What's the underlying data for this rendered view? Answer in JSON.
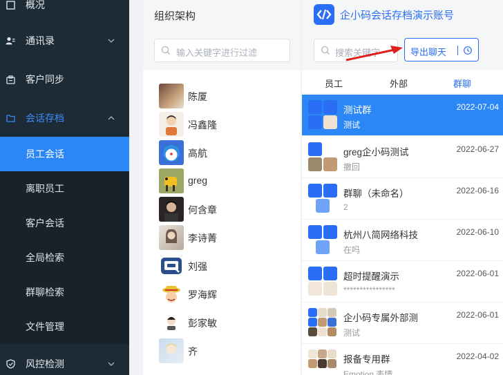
{
  "sidebar": {
    "items": [
      {
        "label": "概况",
        "icon": "dashboard-icon"
      },
      {
        "label": "通讯录",
        "icon": "contacts-icon"
      },
      {
        "label": "客户同步",
        "icon": "sync-icon"
      },
      {
        "label": "会话存档",
        "icon": "folder-icon"
      },
      {
        "label": "风控检测",
        "icon": "shield-icon"
      }
    ],
    "sub_items": [
      "员工会话",
      "离职员工",
      "客户会话",
      "全局检索",
      "群聊检索",
      "文件管理"
    ],
    "active_sub": "员工会话",
    "accent": "#2b87f5"
  },
  "org": {
    "title": "组织架构",
    "search_placeholder": "输入关键字进行过滤",
    "people": [
      "陈厦",
      "冯鑫隆",
      "高航",
      "greg",
      "何含章",
      "李诗菁",
      "刘强",
      "罗海辉",
      "彭家敏",
      "齐"
    ]
  },
  "chat": {
    "account_name": "企小码会话存档演示账号",
    "search_placeholder": "搜索关键字",
    "export_label": "导出聊天",
    "tabs": [
      "员工",
      "外部",
      "群聊"
    ],
    "active_tab": "群聊",
    "conversations": [
      {
        "name": "测试群",
        "date": "2022-07-04",
        "msg": "测试"
      },
      {
        "name": "greg企小码测试",
        "date": "2022-06-27",
        "msg": "撤回"
      },
      {
        "name": "群聊（未命名）",
        "date": "2022-06-16",
        "msg": "2"
      },
      {
        "name": "杭州八简网络科技",
        "date": "2022-06-10",
        "msg": "在吗"
      },
      {
        "name": "超时提醒演示",
        "date": "2022-06-01",
        "msg": "****************"
      },
      {
        "name": "企小码专属外部测",
        "date": "2022-06-01",
        "msg": "测试"
      },
      {
        "name": "报备专用群",
        "date": "2022-04-02",
        "msg": "Emotion 表情"
      }
    ]
  }
}
